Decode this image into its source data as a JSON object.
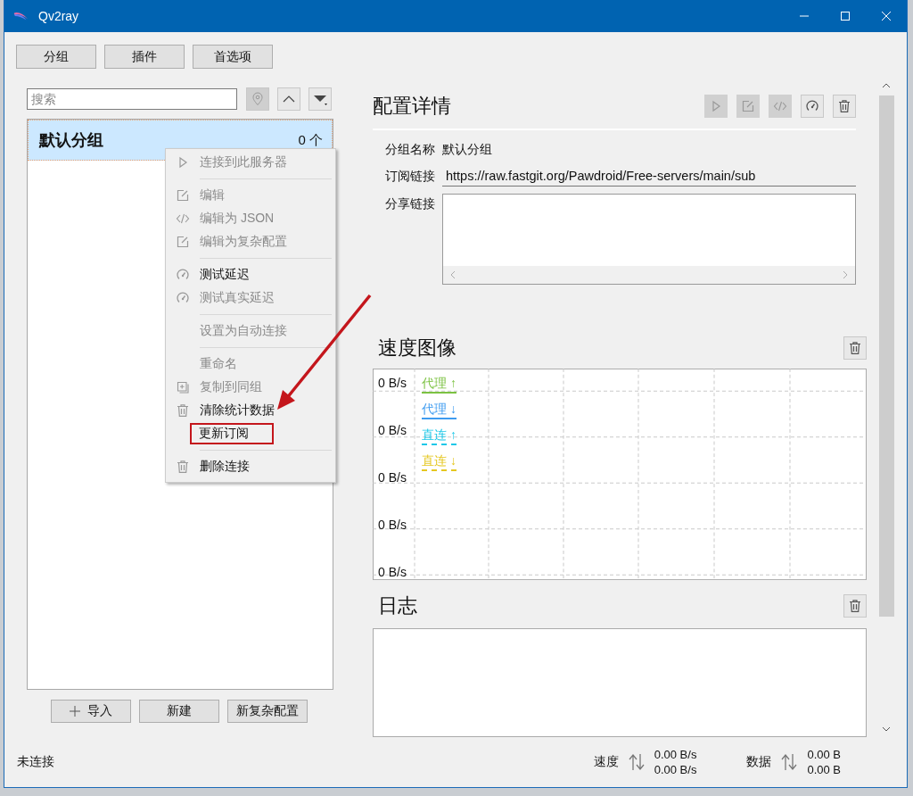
{
  "window": {
    "title": "Qv2ray"
  },
  "top_buttons": [
    "分组",
    "插件",
    "首选项"
  ],
  "search": {
    "placeholder": "搜索"
  },
  "groups": [
    {
      "name": "默认分组",
      "count": "0 个",
      "selected": true
    }
  ],
  "context_menu": {
    "items": [
      {
        "kind": "item",
        "label": "连接到此服务器",
        "disabled": true,
        "marked": false
      },
      {
        "kind": "separator"
      },
      {
        "kind": "item",
        "label": "编辑",
        "disabled": true,
        "marked": false
      },
      {
        "kind": "item",
        "label": "编辑为 JSON",
        "disabled": true,
        "marked": false
      },
      {
        "kind": "item",
        "label": "编辑为复杂配置",
        "disabled": true,
        "marked": false
      },
      {
        "kind": "separator"
      },
      {
        "kind": "item",
        "label": "测试延迟",
        "disabled": false,
        "marked": false
      },
      {
        "kind": "item",
        "label": "测试真实延迟",
        "disabled": true,
        "marked": false
      },
      {
        "kind": "separator"
      },
      {
        "kind": "item",
        "label": "设置为自动连接",
        "disabled": true,
        "marked": false
      },
      {
        "kind": "separator"
      },
      {
        "kind": "item",
        "label": "重命名",
        "disabled": true,
        "marked": false
      },
      {
        "kind": "item",
        "label": "复制到同组",
        "disabled": true,
        "marked": false
      },
      {
        "kind": "item",
        "label": "清除统计数据",
        "disabled": false,
        "marked": false
      },
      {
        "kind": "item",
        "label": "更新订阅",
        "disabled": false,
        "marked": true
      },
      {
        "kind": "separator"
      },
      {
        "kind": "item",
        "label": "删除连接",
        "disabled": false,
        "marked": false
      }
    ]
  },
  "list_buttons": [
    "导入",
    "新建",
    "新复杂配置"
  ],
  "details": {
    "title": "配置详情",
    "actions": [
      {
        "disabled": true
      },
      {
        "disabled": true
      },
      {
        "disabled": true
      },
      {
        "disabled": false
      },
      {
        "disabled": false
      }
    ],
    "fields": [
      {
        "kind": "text",
        "label": "分组名称",
        "value": "默认分组"
      },
      {
        "kind": "line",
        "label": "订阅链接",
        "value": "https://raw.fastgit.org/Pawdroid/Free-servers/main/sub"
      },
      {
        "kind": "area",
        "label": "分享链接"
      }
    ]
  },
  "speed_chart": {
    "title": "速度图像",
    "axis_labels": [
      "0 B/s",
      "0 B/s",
      "0 B/s",
      "0 B/s",
      "0 B/s"
    ],
    "legend": [
      {
        "label": "代理 ↑",
        "color": "#7cc242",
        "dashed": false
      },
      {
        "label": "代理 ↓",
        "color": "#3d9bf0",
        "dashed": false
      },
      {
        "label": "直连 ↑",
        "color": "#1ec8e8",
        "dashed": true
      },
      {
        "label": "直连 ↓",
        "color": "#e5c720",
        "dashed": true
      }
    ]
  },
  "log": {
    "title": "日志"
  },
  "status": {
    "text": "未连接",
    "speed_label": "速度",
    "speed_up": "0.00 B/s",
    "speed_down": "0.00 B/s",
    "data_label": "数据",
    "data_up": "0.00 B",
    "data_down": "0.00 B"
  }
}
